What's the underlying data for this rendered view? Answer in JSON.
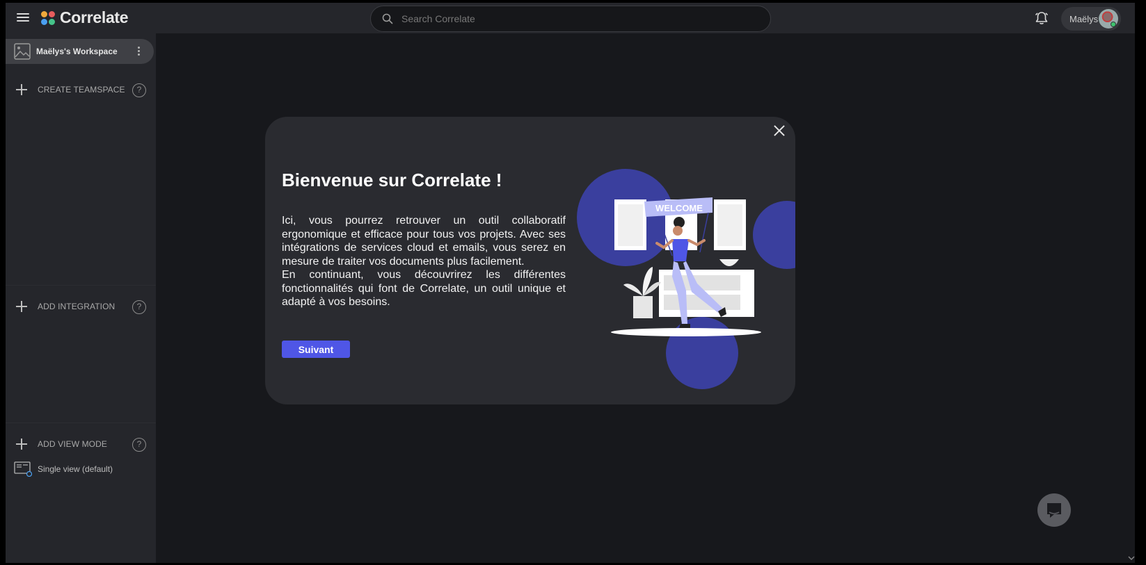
{
  "app": {
    "name": "Correlate",
    "logo_colors": [
      "#f2a93b",
      "#e85d5d",
      "#4a9ff0",
      "#45c48a"
    ]
  },
  "topbar": {
    "search_placeholder": "Search Correlate",
    "user_name": "Maëlys",
    "icons": [
      "menu-icon",
      "search-icon",
      "bell-icon",
      "avatar"
    ]
  },
  "sidebar": {
    "workspace_label": "Maëlys's Workspace",
    "create_teamspace": "CREATE TEAMSPACE",
    "add_integration": "ADD INTEGRATION",
    "add_view_mode": "ADD VIEW MODE",
    "help_glyph": "?",
    "view_items": [
      {
        "label": "Single view (default)"
      }
    ]
  },
  "modal": {
    "title": "Bienvenue sur Correlate !",
    "paragraph_1": "Ici, vous pourrez retrouver un outil collaboratif ergonomique et efficace pour tous vos projets. Avec ses intégrations de services cloud et emails, vous serez en mesure de traiter vos documents plus facilement.",
    "paragraph_2": "En continuant, vous découvrirez les différentes fonctionnalités qui font de Correlate, un outil unique et adapté à vos besoins.",
    "next_label": "Suivant",
    "illustration_banner": "WELCOME",
    "accent_color": "#4f56e6",
    "circle_color": "#3a3f9e"
  }
}
